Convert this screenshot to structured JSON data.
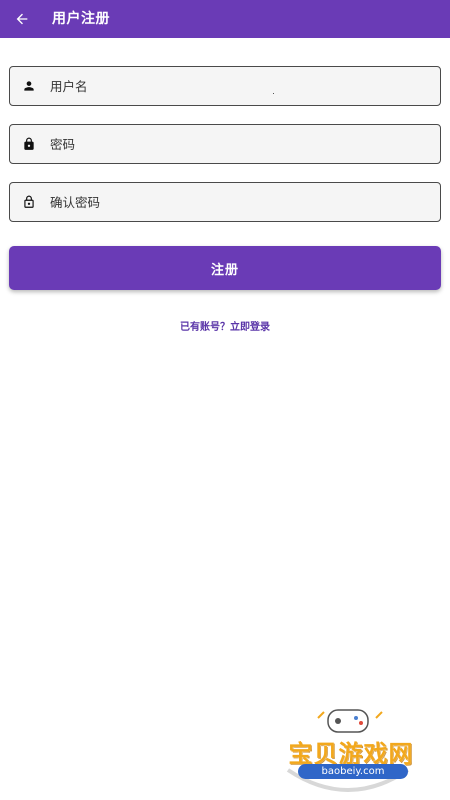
{
  "appbar": {
    "title": "用户注册",
    "back_icon": "arrow-left-icon"
  },
  "form": {
    "username": {
      "placeholder": "用户名",
      "value": "",
      "icon": "person-icon"
    },
    "password": {
      "placeholder": "密码",
      "value": "",
      "icon": "lock-icon"
    },
    "confirm_password": {
      "placeholder": "确认密码",
      "value": "",
      "icon": "lock-open-icon"
    }
  },
  "submit_label": "注册",
  "login_link": "已有账号？立即登录",
  "watermark": {
    "brand": "宝贝游戏网",
    "url": "baobeiy.com"
  },
  "colors": {
    "primary": "#6a3bb6",
    "link": "#5a35a8",
    "field_bg": "#f5f5f5"
  }
}
